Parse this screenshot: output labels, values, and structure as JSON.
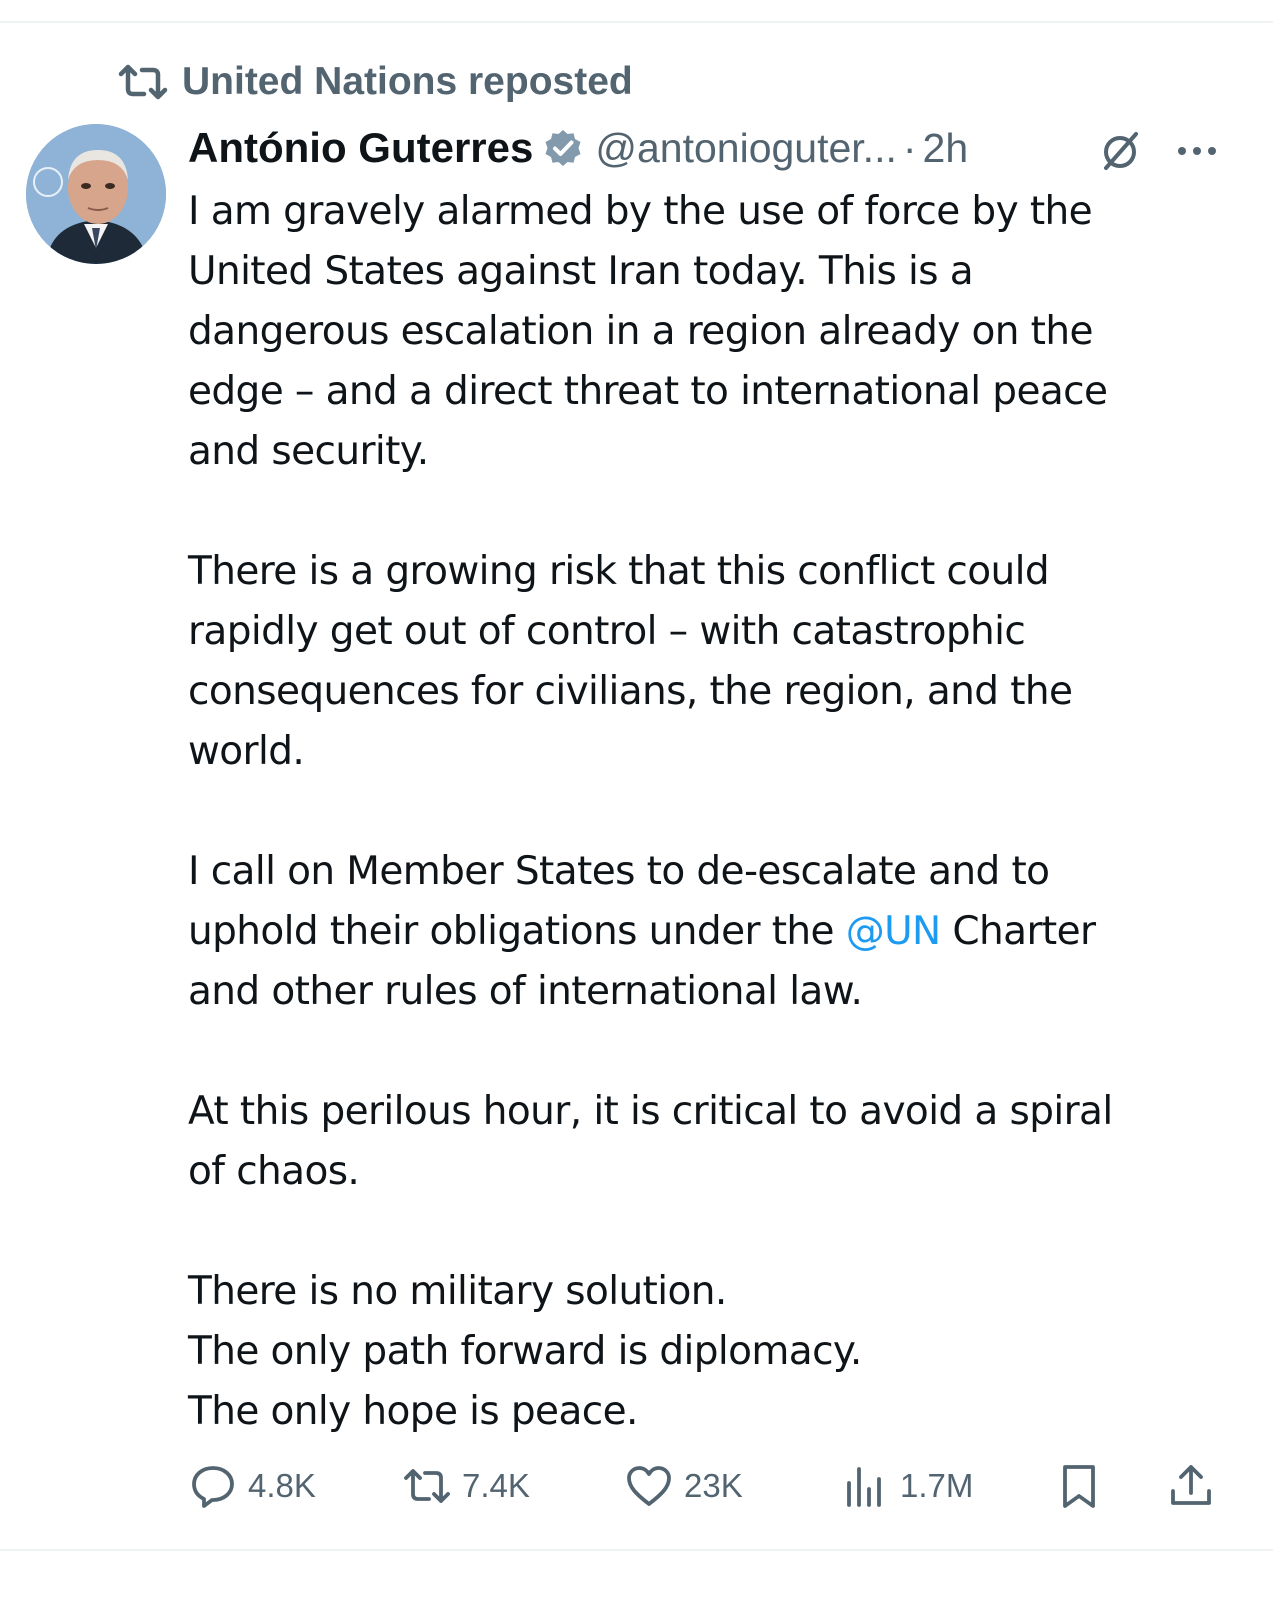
{
  "repost": {
    "label": "United Nations reposted"
  },
  "tweet": {
    "author_name": "António Guterres",
    "handle": "@antonioguter...",
    "separator": "·",
    "time": "2h",
    "paragraphs": [
      [
        "I am gravely alarmed by the use of force by the",
        "United States against Iran today. This is a",
        "dangerous escalation in a region already on the",
        "edge – and a direct threat to international peace",
        "and security."
      ],
      [
        "There is a growing risk that this conflict could",
        "rapidly get out of control – with catastrophic",
        "consequences for civilians, the region, and the",
        "world."
      ],
      [
        "I call on Member States to de-escalate and to"
      ],
      [
        "At this perilous hour, it is critical to avoid a spiral",
        "of chaos."
      ],
      [
        "There is no military solution.",
        "The only path forward is diplomacy.",
        "The only hope is peace."
      ]
    ],
    "para3_line2_before": "uphold their obligations under the ",
    "para3_mention": "@UN",
    "para3_line2_after": " Charter",
    "para3_line3": "and other rules of international law."
  },
  "actions": {
    "replies": "4.8K",
    "reposts": "7.4K",
    "likes": "23K",
    "views": "1.7M"
  },
  "colors": {
    "secondary_text": "#536471",
    "primary_text": "#0f1419",
    "link": "#1d9bf0",
    "divider": "#eff3f4"
  },
  "icons": [
    "repost-icon",
    "verified-badge-icon",
    "grok-icon",
    "more-icon",
    "reply-icon",
    "retweet-icon",
    "like-icon",
    "views-icon",
    "bookmark-icon",
    "share-icon"
  ]
}
